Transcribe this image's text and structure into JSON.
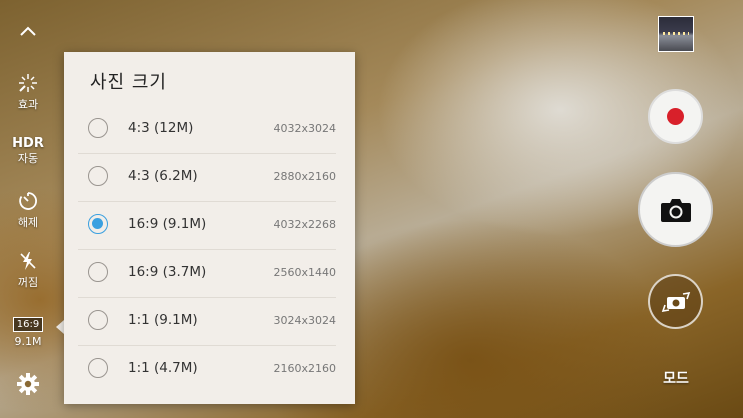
{
  "left_bar": {
    "collapse_icon": "chevron-up-icon",
    "effects": {
      "icon": "sparkle-icon",
      "label": "효과"
    },
    "hdr": {
      "title": "HDR",
      "label": "자동"
    },
    "timer": {
      "icon": "timer-icon",
      "label": "해제"
    },
    "flash": {
      "icon": "flash-off-icon",
      "label": "꺼짐"
    },
    "picture_size": {
      "ratio": "16:9",
      "label": "9.1M"
    },
    "settings": {
      "icon": "gear-icon"
    }
  },
  "panel": {
    "title": "사진 크기",
    "options": [
      {
        "name": "4:3 (12M)",
        "resolution": "4032x3024",
        "selected": false
      },
      {
        "name": "4:3 (6.2M)",
        "resolution": "2880x2160",
        "selected": false
      },
      {
        "name": "16:9 (9.1M)",
        "resolution": "4032x2268",
        "selected": true
      },
      {
        "name": "16:9 (3.7M)",
        "resolution": "2560x1440",
        "selected": false
      },
      {
        "name": "1:1 (9.1M)",
        "resolution": "3024x3024",
        "selected": false
      },
      {
        "name": "1:1 (4.7M)",
        "resolution": "2160x2160",
        "selected": false
      }
    ]
  },
  "right_bar": {
    "gallery_thumbnail": "gallery-thumbnail",
    "record_icon": "record-icon",
    "shutter_icon": "camera-icon",
    "switch_icon": "switch-camera-icon",
    "mode_label": "모드"
  },
  "colors": {
    "record": "#d8202a",
    "radio_selected": "#3aa0e0",
    "panel_bg": "#f2eee9"
  }
}
